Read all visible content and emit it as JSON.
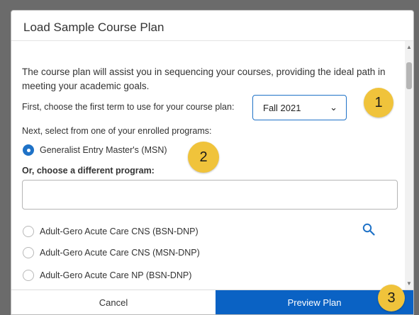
{
  "dialog": {
    "title": "Load Sample Course Plan",
    "intro_text": "The course plan will assist you in sequencing your courses, providing the ideal path in meeting your academic goals.",
    "term_prompt": "First, choose the first term to use for your course plan:",
    "term_select": {
      "value": "Fall 2021"
    },
    "enrolled_prompt": "Next, select from one of your enrolled programs:",
    "enrolled_program": {
      "label": "Generalist Entry Master's (MSN)",
      "selected": true
    },
    "different_prompt": "Or, choose a different program:",
    "program_input": {
      "value": "",
      "placeholder": ""
    },
    "programs": [
      {
        "label": "Adult-Gero Acute Care CNS (BSN-DNP)"
      },
      {
        "label": "Adult-Gero Acute Care CNS (MSN-DNP)"
      },
      {
        "label": "Adult-Gero Acute Care NP (BSN-DNP)"
      }
    ],
    "cancel_label": "Cancel",
    "preview_label": "Preview Plan"
  },
  "annotations": {
    "marker1": "1",
    "marker2": "2",
    "marker3": "3"
  },
  "colors": {
    "accent": "#0a62c4",
    "marker": "#f0c33b",
    "backdrop": "#6b6b6b"
  },
  "icons": [
    "search-icon",
    "chevron-down-icon",
    "scroll-up-icon",
    "scroll-down-icon"
  ]
}
